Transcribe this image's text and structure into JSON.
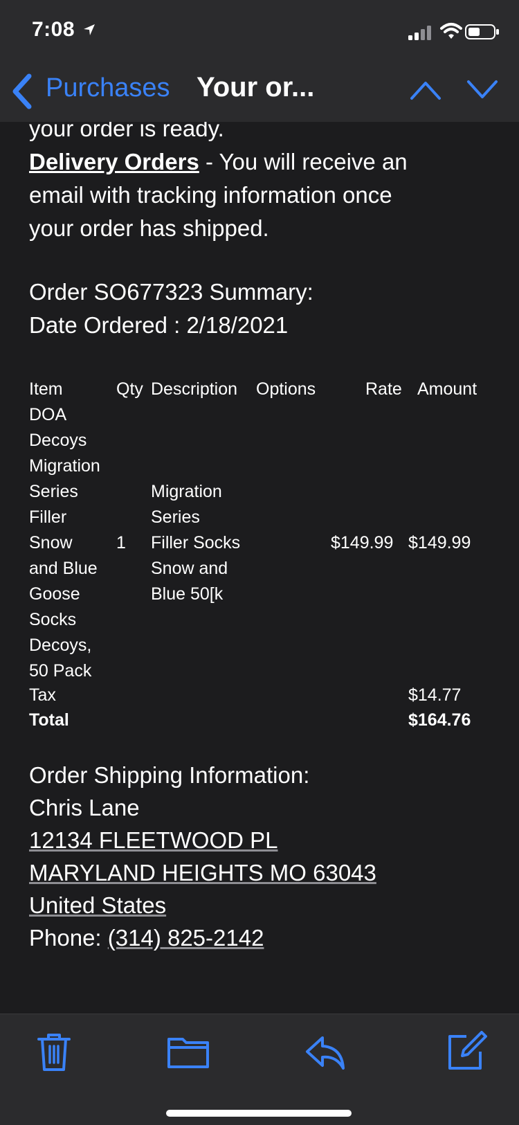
{
  "status_bar": {
    "time": "7:08"
  },
  "nav": {
    "back_label": "Purchases",
    "title": "Your or..."
  },
  "email": {
    "intro_line1": "your order is ready.",
    "delivery_label": "Delivery Orders",
    "delivery_text": " - You will receive an",
    "intro_line3": "email with tracking information once",
    "intro_line4": "your order has shipped.",
    "order_summary": "Order SO677323 Summary:",
    "date_ordered": "Date Ordered : 2/18/2021",
    "table": {
      "headers": {
        "item": "Item",
        "qty": "Qty",
        "description": "Description",
        "options": "Options",
        "rate": "Rate",
        "amount": "Amount"
      },
      "row": {
        "item_lines": [
          "DOA",
          "Decoys",
          "Migration",
          "Series",
          "Filler",
          "Snow",
          "and Blue",
          "Goose",
          "Socks",
          "Decoys,",
          "50 Pack"
        ],
        "qty": "1",
        "description_lines": [
          "Migration",
          "Series",
          "Filler Socks",
          "Snow and",
          "Blue 50[k"
        ],
        "rate": "$149.99",
        "amount": "$149.99"
      },
      "tax_label": "Tax",
      "tax_value": "$14.77",
      "total_label": "Total",
      "total_value": "$164.76"
    },
    "shipping": {
      "heading": "Order Shipping Information:",
      "name": "Chris Lane",
      "street": "12134 FLEETWOOD PL",
      "city": "MARYLAND HEIGHTS MO 63043",
      "country": "United States",
      "phone_label": "Phone: ",
      "phone": "(314) 825-2142"
    }
  },
  "colors": {
    "accent": "#3a82f7",
    "background": "#1c1c1e",
    "bar": "#2b2b2d"
  },
  "toolbar": {
    "icons": [
      "trash-icon",
      "folder-icon",
      "reply-icon",
      "compose-icon"
    ]
  }
}
